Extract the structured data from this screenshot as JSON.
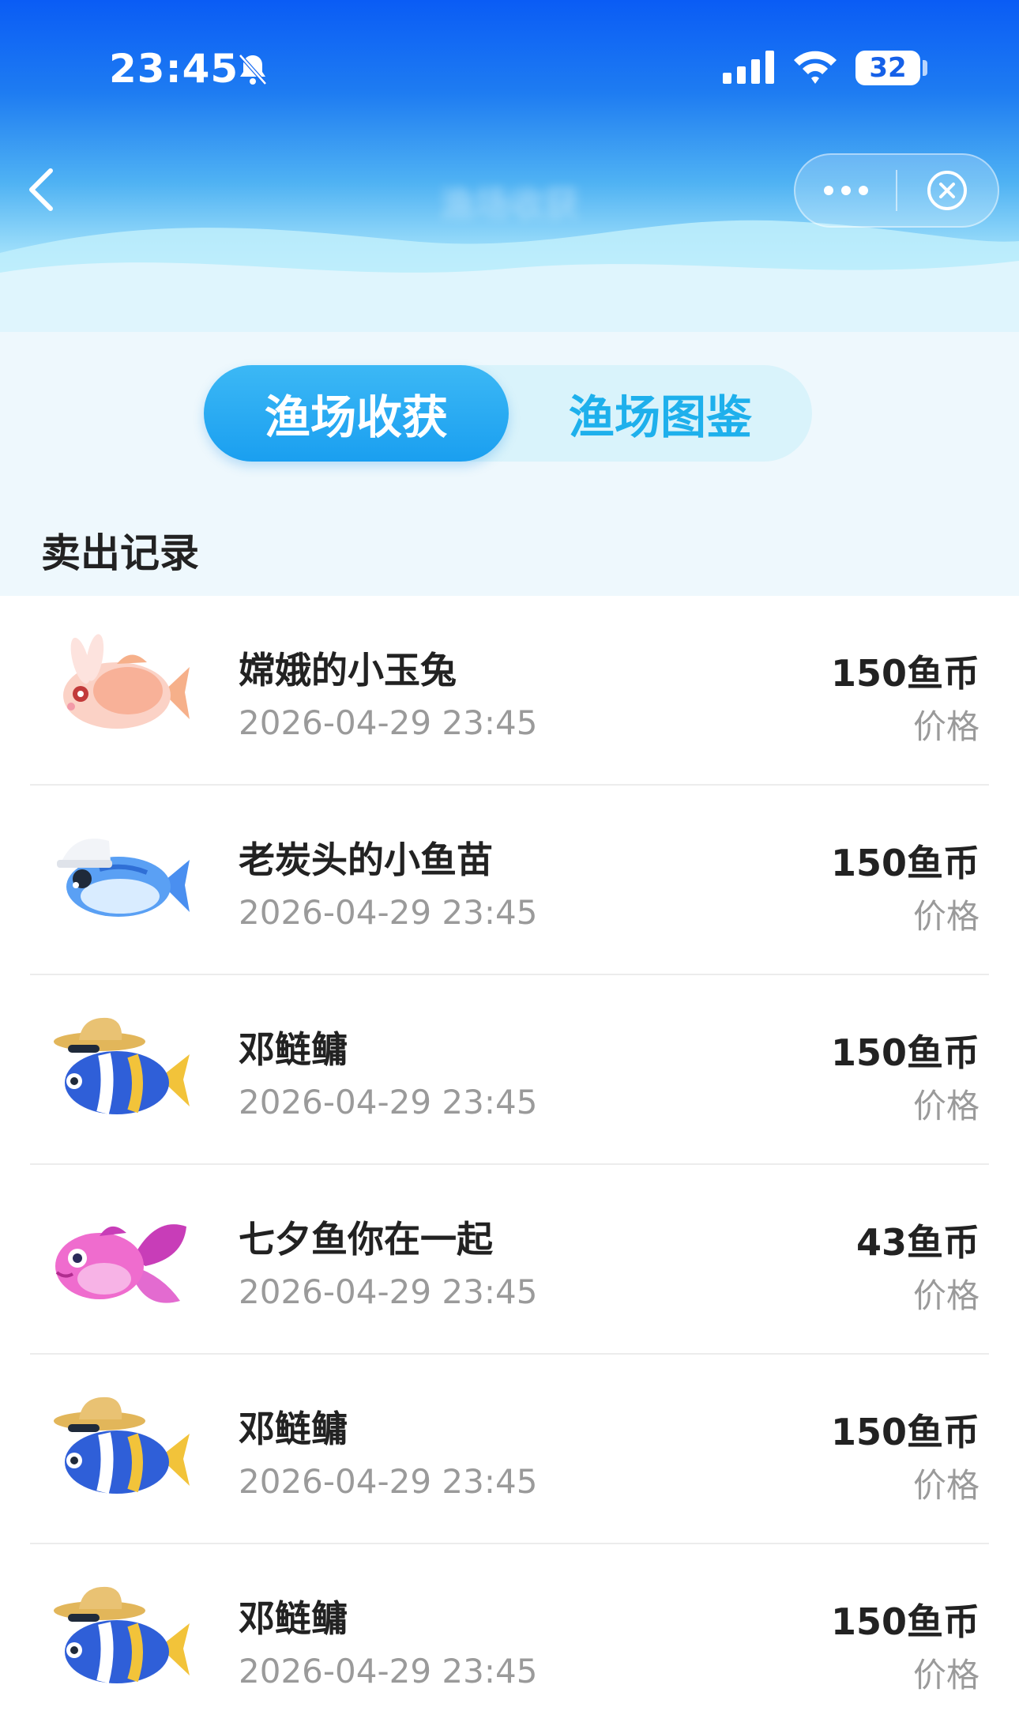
{
  "status_bar": {
    "time": "23:45",
    "battery": "32"
  },
  "nav": {
    "title": "渔场收获"
  },
  "tabs": [
    {
      "label": "渔场收获",
      "active": true
    },
    {
      "label": "渔场图鉴",
      "active": false
    }
  ],
  "section": {
    "title": "卖出记录"
  },
  "records": [
    {
      "name": "嫦娥的小玉兔",
      "date": "2026-04-29 23:45",
      "price": "150鱼币",
      "price_label": "价格",
      "icon": "rabbit-fish-icon"
    },
    {
      "name": "老炭头的小鱼苗",
      "date": "2026-04-29 23:45",
      "price": "150鱼币",
      "price_label": "价格",
      "icon": "cap-fish-icon"
    },
    {
      "name": "邓鲢鳙",
      "date": "2026-04-29 23:45",
      "price": "150鱼币",
      "price_label": "价格",
      "icon": "hat-fish-icon"
    },
    {
      "name": "七夕鱼你在一起",
      "date": "2026-04-29 23:45",
      "price": "43鱼币",
      "price_label": "价格",
      "icon": "butterfly-fish-icon"
    },
    {
      "name": "邓鲢鳙",
      "date": "2026-04-29 23:45",
      "price": "150鱼币",
      "price_label": "价格",
      "icon": "hat-fish-icon"
    },
    {
      "name": "邓鲢鳙",
      "date": "2026-04-29 23:45",
      "price": "150鱼币",
      "price_label": "价格",
      "icon": "hat-fish-icon"
    }
  ],
  "colors": {
    "header_top": "#0a5cf5",
    "accent": "#1a9ff0",
    "tab_inactive_text": "#1eb0ec",
    "muted_text": "#9a9a9a"
  }
}
